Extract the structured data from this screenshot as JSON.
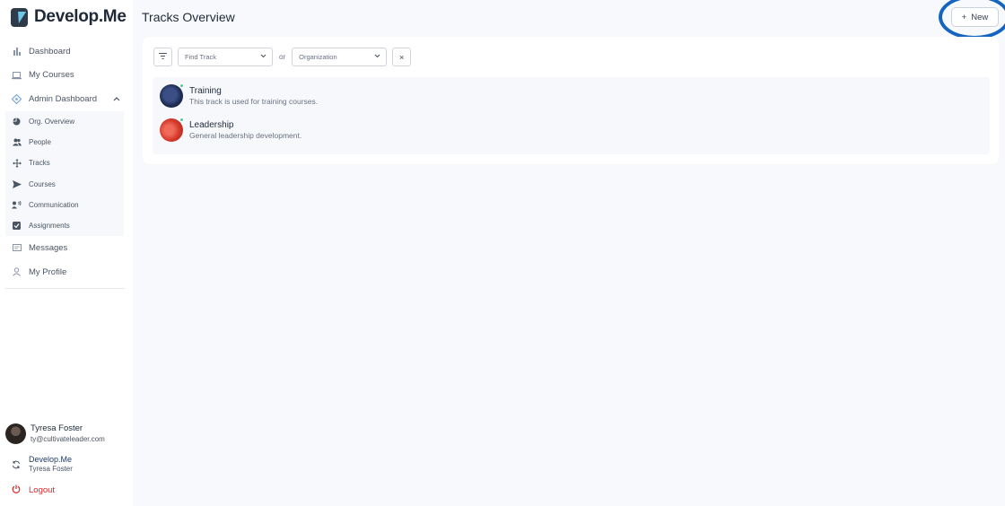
{
  "app": {
    "name": "Develop.Me"
  },
  "nav": {
    "items": [
      {
        "label": "Dashboard",
        "icon": "bar-chart-icon"
      },
      {
        "label": "My Courses",
        "icon": "laptop-icon"
      },
      {
        "label": "Admin Dashboard",
        "icon": "diamond-arrows-icon"
      }
    ],
    "admin_sub": [
      {
        "label": "Org. Overview",
        "icon": "pie-chart-icon"
      },
      {
        "label": "People",
        "icon": "people-icon"
      },
      {
        "label": "Tracks",
        "icon": "move-arrows-icon"
      },
      {
        "label": "Courses",
        "icon": "send-icon"
      },
      {
        "label": "Communication",
        "icon": "communication-icon"
      },
      {
        "label": "Assignments",
        "icon": "check-square-icon"
      }
    ],
    "lower": [
      {
        "label": "Messages",
        "icon": "message-icon"
      },
      {
        "label": "My Profile",
        "icon": "user-icon"
      }
    ]
  },
  "user": {
    "name": "Tyresa Foster",
    "email": "ty@cultivateleader.com"
  },
  "org": {
    "name": "Develop.Me",
    "user": "Tyresa Foster"
  },
  "logout_label": "Logout",
  "page": {
    "title": "Tracks Overview",
    "new_label": "New",
    "new_icon": "+"
  },
  "filters": {
    "track_placeholder": "Find Track",
    "or_label": "or",
    "org_placeholder": "Organization",
    "clear_icon": "×"
  },
  "tracks": [
    {
      "name": "Training",
      "description": "This track is used for training courses.",
      "color": "#1e2c52"
    },
    {
      "name": "Leadership",
      "description": "General leadership development.",
      "color": "#d63a2c"
    }
  ],
  "colors": {
    "accent": "#1565c0",
    "logout": "#dc2626",
    "status_dot": "#34d399"
  }
}
